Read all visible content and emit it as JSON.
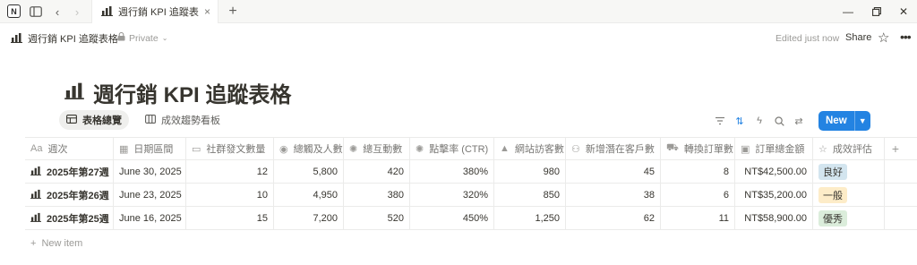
{
  "browser": {
    "tab_title": "週行銷 KPI 追蹤表格 | ...",
    "tab_close": "×",
    "new_tab": "+"
  },
  "header": {
    "breadcrumb": "週行銷 KPI 追蹤表格",
    "privacy": "Private",
    "edited": "Edited just now",
    "share": "Share"
  },
  "page": {
    "title": "週行銷 KPI 追蹤表格",
    "views": [
      {
        "label": "表格總覽",
        "active": true
      },
      {
        "label": "成效趨勢看板",
        "active": false
      }
    ],
    "new_button": "New"
  },
  "table": {
    "columns": [
      {
        "label": "週次",
        "icon": "Aa"
      },
      {
        "label": "日期區間",
        "icon": "calendar-icon"
      },
      {
        "label": "社群發文數量",
        "icon": "post-icon"
      },
      {
        "label": "總觸及人數",
        "icon": "eye-icon"
      },
      {
        "label": "總互動數",
        "icon": "sparkle-icon"
      },
      {
        "label": "點擊率 (CTR)",
        "icon": "click-icon"
      },
      {
        "label": "網站訪客數",
        "icon": "triangle-icon"
      },
      {
        "label": "新增潛在客戶數",
        "icon": "users-icon"
      },
      {
        "label": "轉換訂單數",
        "icon": "cart-icon"
      },
      {
        "label": "訂單總金額",
        "icon": "money-icon"
      },
      {
        "label": "成效評估",
        "icon": "star-icon"
      }
    ],
    "rows": [
      {
        "week": "2025年第27週",
        "date": "June 30, 2025",
        "posts": "12",
        "reach": "5,800",
        "interactions": "420",
        "ctr": "380%",
        "visitors": "980",
        "leads": "45",
        "orders": "8",
        "revenue": "NT$42,500.00",
        "rating": "良好",
        "rating_color": "blue"
      },
      {
        "week": "2025年第26週",
        "date": "June 23, 2025",
        "posts": "10",
        "reach": "4,950",
        "interactions": "380",
        "ctr": "320%",
        "visitors": "850",
        "leads": "38",
        "orders": "6",
        "revenue": "NT$35,200.00",
        "rating": "一般",
        "rating_color": "yellow"
      },
      {
        "week": "2025年第25週",
        "date": "June 16, 2025",
        "posts": "15",
        "reach": "7,200",
        "interactions": "520",
        "ctr": "450%",
        "visitors": "1,250",
        "leads": "62",
        "orders": "11",
        "revenue": "NT$58,900.00",
        "rating": "優秀",
        "rating_color": "green"
      }
    ],
    "new_item": "New item"
  },
  "colors": {
    "accent": "#2383e2",
    "pill_blue": "#d3e5ef",
    "pill_yellow": "#fdecc8",
    "pill_green": "#dbeddb"
  }
}
